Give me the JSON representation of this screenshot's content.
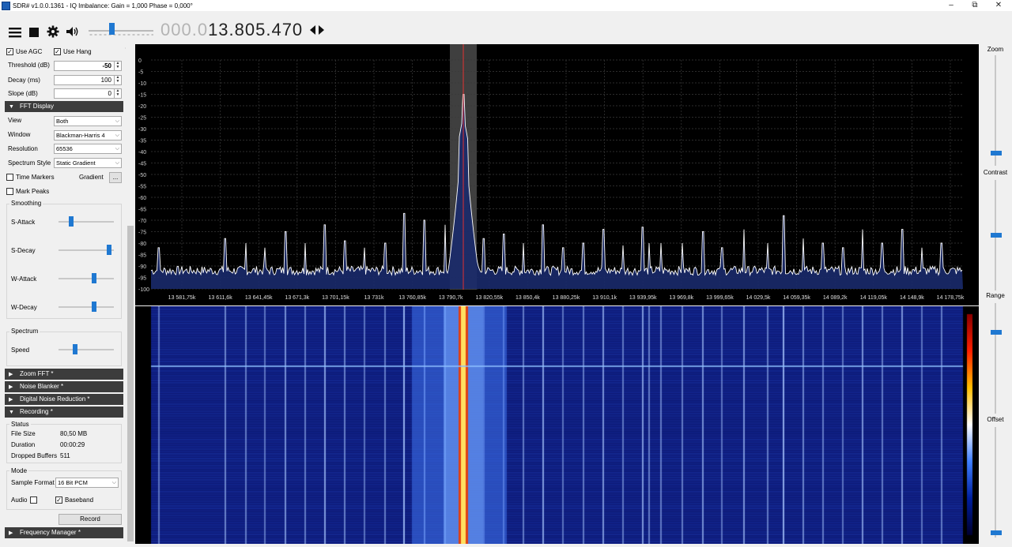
{
  "window": {
    "title": "SDR# v1.0.0.1361 - IQ Imbalance: Gain = 1,000 Phase = 0,000°",
    "minimize": "–",
    "restore": "⧉",
    "close": "✕"
  },
  "toolbar": {
    "menu_icon": "hamburger-icon",
    "stop_icon": "stop-icon",
    "settings_icon": "gear-icon",
    "audio_icon": "speaker-icon",
    "freq_dim": "000.0",
    "freq_bright": "13.805.470",
    "tune_icon": "left-right-arrows-icon",
    "volume_level": 0.35
  },
  "agc": {
    "use_agc_label": "Use AGC",
    "use_agc_checked": true,
    "use_hang_label": "Use Hang",
    "use_hang_checked": true,
    "threshold_label": "Threshold (dB)",
    "threshold_value": "-50",
    "decay_label": "Decay (ms)",
    "decay_value": "100",
    "slope_label": "Slope (dB)",
    "slope_value": "0"
  },
  "fft": {
    "section_label": "FFT Display",
    "view_label": "View",
    "view_value": "Both",
    "window_label": "Window",
    "window_value": "Blackman-Harris 4",
    "resolution_label": "Resolution",
    "resolution_value": "65536",
    "style_label": "Spectrum Style",
    "style_value": "Static Gradient",
    "time_markers_label": "Time Markers",
    "gradient_label": "Gradient",
    "gradient_button": "...",
    "mark_peaks_label": "Mark Peaks",
    "smoothing_title": "Smoothing",
    "s_attack_label": "S-Attack",
    "s_attack_level": 0.2,
    "s_decay_label": "S-Decay",
    "s_decay_level": 0.95,
    "w_attack_label": "W-Attack",
    "w_attack_level": 0.65,
    "w_decay_label": "W-Decay",
    "w_decay_level": 0.65,
    "spectrum_title": "Spectrum",
    "speed_label": "Speed",
    "speed_level": 0.28
  },
  "sections": {
    "zoom_fft": "Zoom FFT *",
    "noise_blanker": "Noise Blanker *",
    "dnr": "Digital Noise Reduction *",
    "recording": "Recording *",
    "freq_manager": "Frequency Manager *"
  },
  "recording": {
    "status_title": "Status",
    "file_size_label": "File Size",
    "file_size_value": "80,50 MB",
    "duration_label": "Duration",
    "duration_value": "00:00:29",
    "dropped_label": "Dropped Buffers",
    "dropped_value": "511",
    "mode_title": "Mode",
    "sample_format_label": "Sample Format",
    "sample_format_value": "16 Bit PCM",
    "audio_label": "Audio",
    "baseband_label": "Baseband",
    "baseband_checked": true,
    "record_button": "Record"
  },
  "right_panel": {
    "zoom_label": "Zoom",
    "zoom_level": 0.1,
    "contrast_label": "Contrast",
    "contrast_level": 0.5,
    "range_label": "Range",
    "range_level": 0.75,
    "offset_label": "Offset",
    "offset_level": 0.02
  },
  "chart_data": {
    "type": "line",
    "ylabels": [
      "0",
      "-5",
      "-10",
      "-15",
      "-20",
      "-25",
      "-30",
      "-35",
      "-40",
      "-45",
      "-50",
      "-55",
      "-60",
      "-65",
      "-70",
      "-75",
      "-80",
      "-85",
      "-90",
      "-95",
      "-100"
    ],
    "xlabels": [
      "13 581,75k",
      "13 611,6k",
      "13 641,45k",
      "13 671,3k",
      "13 701,15k",
      "13 731k",
      "13 760,85k",
      "13 790,7k",
      "13 820,55k",
      "13 850,4k",
      "13 880,25k",
      "13 910,1k",
      "13 939,95k",
      "13 969,8k",
      "13 999,65k",
      "14 029,5k",
      "14 059,35k",
      "14 089,2k",
      "14 119,05k",
      "14 148,9k",
      "14 178,75k"
    ],
    "ylim": [
      -100,
      0
    ],
    "center_peak_db": -15,
    "noise_floor_db": -92,
    "colors": {
      "trace": "#ffffff",
      "fill": "#1a2a6c",
      "grid": "#3a3a3a",
      "center_line": "#e03030",
      "band": "#5a5a5a"
    }
  }
}
